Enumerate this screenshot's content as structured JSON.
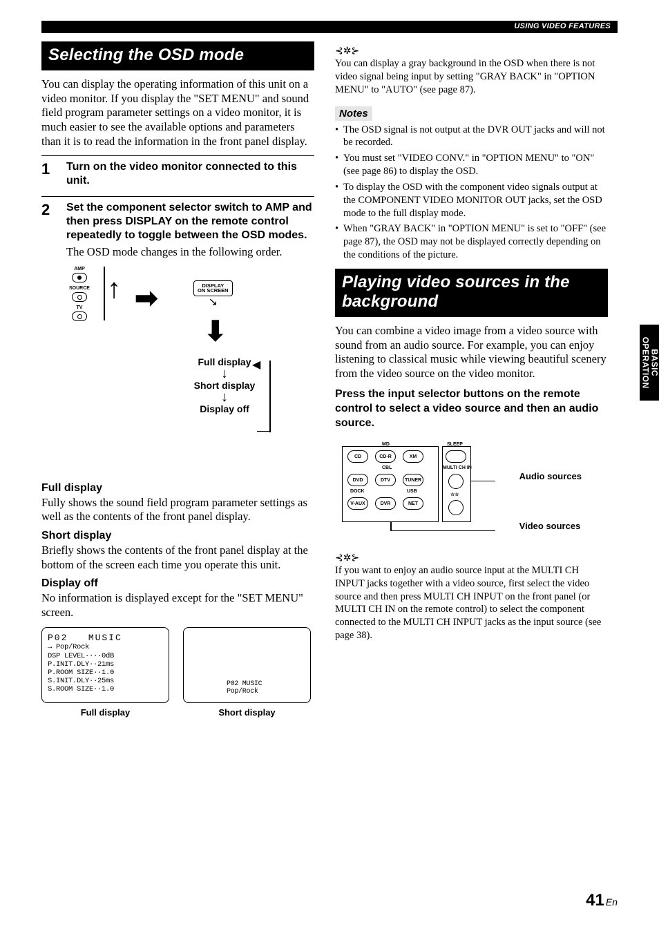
{
  "header": {
    "section": "USING VIDEO FEATURES"
  },
  "sidetab": {
    "line1": "BASIC",
    "line2": "OPERATION"
  },
  "left": {
    "title": "Selecting the OSD mode",
    "intro": "You can display the operating information of this unit on a video monitor. If you display the \"SET MENU\" and sound field program parameter settings on a video monitor, it is much easier to see the available options and parameters than it is to read the information in the front panel display.",
    "steps": [
      {
        "num": "1",
        "title": "Turn on the video monitor connected to this unit."
      },
      {
        "num": "2",
        "title": "Set the component selector switch to AMP and then press DISPLAY on the remote control repeatedly to toggle between the OSD modes.",
        "desc": "The OSD mode changes in the following order."
      }
    ],
    "flow": {
      "switch_labels": [
        "AMP",
        "SOURCE",
        "TV"
      ],
      "button": {
        "line1": "DISPLAY",
        "line2": "ON SCREEN"
      },
      "stages": [
        "Full display",
        "Short display",
        "Display off"
      ]
    },
    "modes": [
      {
        "name": "Full display",
        "desc": "Fully shows the sound field program parameter settings as well as the contents of the front panel display."
      },
      {
        "name": "Short display",
        "desc": "Briefly shows the contents of the front panel display at the bottom of the screen each time you operate this unit."
      },
      {
        "name": "Display off",
        "desc": "No information is displayed except for the \"SET MENU\" screen."
      }
    ],
    "osd_full": {
      "header_left": "P02",
      "header_right": "MUSIC",
      "lines": [
        "→   Pop/Rock",
        "  DSP LEVEL····0dB",
        "  P.INIT.DLY··21ms",
        "  P.ROOM SIZE··1.0",
        "  S.INIT.DLY··25ms",
        "  S.ROOM SIZE··1.0"
      ],
      "caption": "Full display"
    },
    "osd_short": {
      "line1": "P02    MUSIC",
      "line2": "     Pop/Rock",
      "caption": "Short display"
    }
  },
  "right": {
    "tip1": "You can display a gray background in the OSD when there is not video signal being input by setting \"GRAY BACK\" in \"OPTION MENU\" to \"AUTO\" (see page 87).",
    "notes_label": "Notes",
    "notes": [
      "The OSD signal is not output at the DVR OUT jacks and will not be recorded.",
      "You must set \"VIDEO CONV.\" in \"OPTION MENU\" to \"ON\" (see page 86) to display the OSD.",
      "To display the OSD with the component video signals output at the COMPONENT VIDEO MONITOR OUT jacks, set the OSD mode to the full display mode.",
      "When \"GRAY BACK\" in \"OPTION MENU\" is set to \"OFF\" (see page 87), the OSD may not be displayed correctly depending on the conditions of the picture."
    ],
    "title2": "Playing video sources in the background",
    "intro2": "You can combine a video image from a video source with sound from an audio source. For example, you can enjoy listening to classical music while viewing beautiful scenery from the video source on the video monitor.",
    "instr": "Press the input selector buttons on the remote control to select a video source and then an audio source.",
    "remote": {
      "row1": [
        "CD",
        "CD-R",
        "XM"
      ],
      "row1_top": "MD",
      "row2": [
        "DVD",
        "DTV",
        "TUNER"
      ],
      "row2_top": "CBL",
      "row3": [
        "V-AUX",
        "DVR",
        "NET"
      ],
      "row3_top_left": "DOCK",
      "row3_top_right": "USB",
      "side_top": "SLEEP",
      "side_mid": "MULTI CH IN",
      "label_audio": "Audio sources",
      "label_video": "Video sources"
    },
    "tip2": "If you want to enjoy an audio source input at the MULTI CH INPUT jacks together with a video source, first select the video source and then press MULTI CH INPUT on the front panel (or MULTI CH IN on the remote control) to select the component connected to the MULTI CH INPUT jacks as the input source (see page 38)."
  },
  "page": {
    "num": "41",
    "suffix": "En"
  }
}
